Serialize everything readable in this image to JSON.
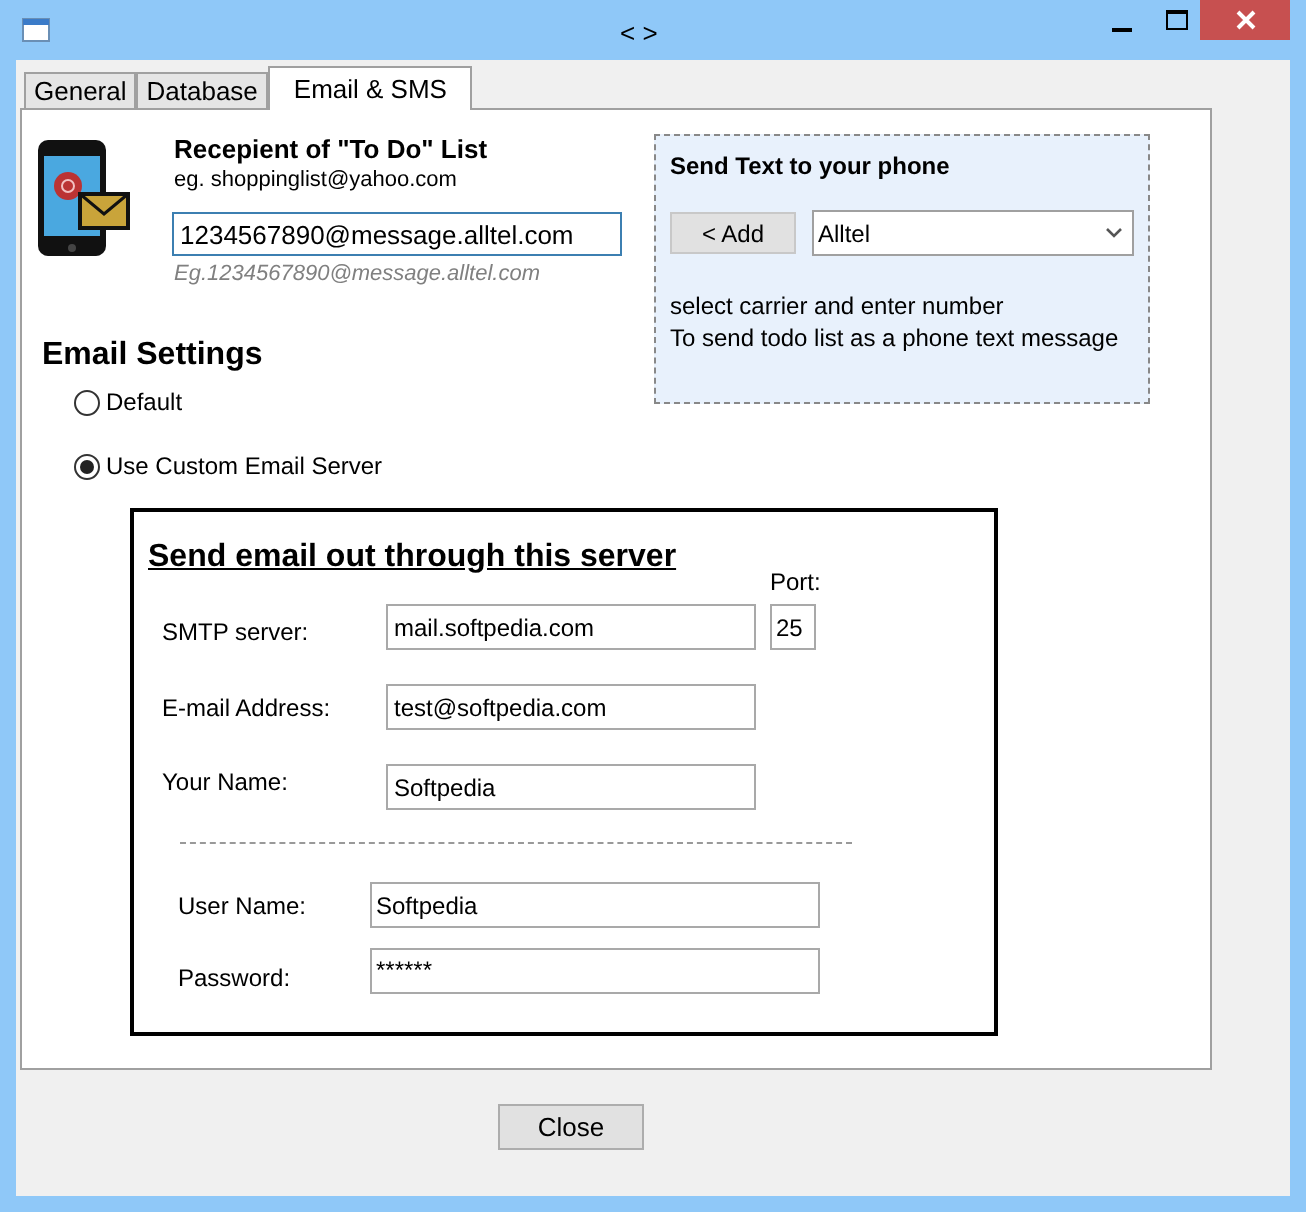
{
  "window": {
    "title": "< >"
  },
  "tabs": [
    {
      "label": "General",
      "selected": false
    },
    {
      "label": "Database",
      "selected": false
    },
    {
      "label": "Email & SMS",
      "selected": true
    }
  ],
  "recipient": {
    "title": "Recepient of \"To Do\" List",
    "example": "eg. shoppinglist@yahoo.com",
    "value": "1234567890@message.alltel.com",
    "hint": "Eg.1234567890@message.alltel.com"
  },
  "sms_box": {
    "title": "Send Text to your phone",
    "add_button": "< Add",
    "carrier": "Alltel",
    "info_lines": [
      "select carrier and enter number",
      "To send todo list as a phone text message"
    ]
  },
  "email_settings": {
    "heading": "Email Settings",
    "options": [
      {
        "label": "Default",
        "selected": false
      },
      {
        "label": "Use Custom Email Server",
        "selected": true
      }
    ]
  },
  "server": {
    "heading": "Send email out through this server",
    "port_label": "Port:",
    "port": "25",
    "fields": [
      {
        "label": "SMTP server:",
        "value": "mail.softpedia.com"
      },
      {
        "label": "E-mail Address:",
        "value": "test@softpedia.com"
      },
      {
        "label": "Your Name:",
        "value": "Softpedia"
      }
    ],
    "credentials": [
      {
        "label": "User Name:",
        "value": "Softpedia"
      },
      {
        "label": "Password:",
        "value": "******"
      }
    ]
  },
  "close_button": "Close"
}
